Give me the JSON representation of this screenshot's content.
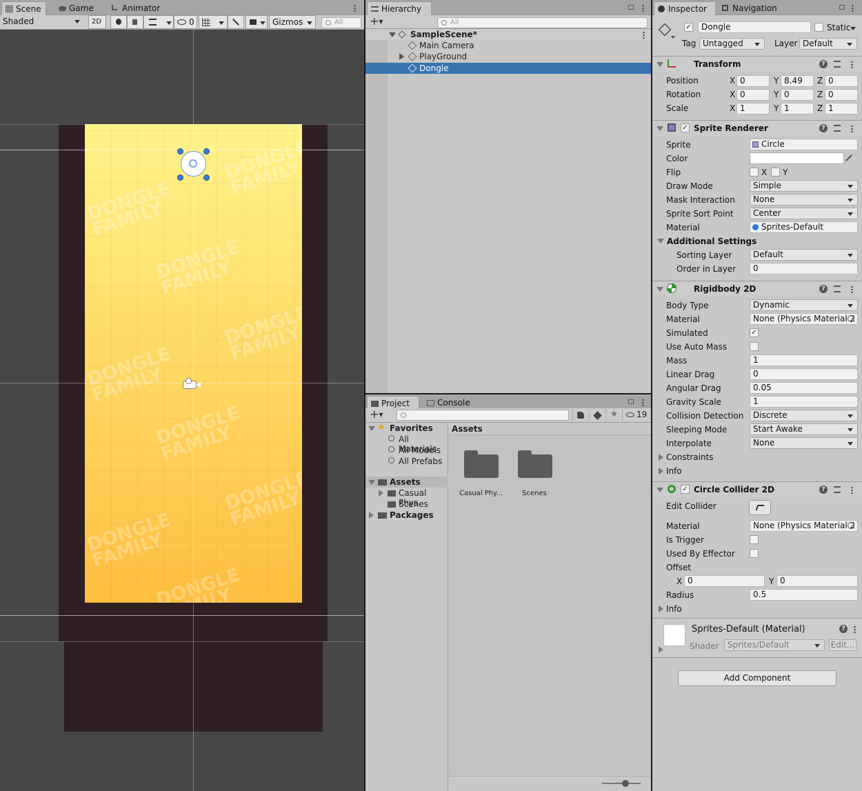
{
  "scene_panel": {
    "tabs": [
      {
        "label": "Scene",
        "active": true
      },
      {
        "label": "Game"
      },
      {
        "label": "Animator"
      }
    ],
    "toolbar": {
      "shading": "Shaded",
      "mode_2d": "2D",
      "hidden_count": "0",
      "gizmos": "Gizmos",
      "search_placeholder": "All"
    },
    "watermark": "DONGLE\nFAMILY",
    "colors": {
      "bg": "#474747",
      "frame": "#2e1f22",
      "grad_top": "#fff38a",
      "grad_bottom": "#ffbe40"
    }
  },
  "hierarchy": {
    "tab": "Hierarchy",
    "search_placeholder": "All",
    "scene": "SampleScene*",
    "items": [
      {
        "label": "Main Camera"
      },
      {
        "label": "PlayGround"
      },
      {
        "label": "Dongle",
        "selected": true
      }
    ]
  },
  "project": {
    "tabs": [
      {
        "label": "Project",
        "active": true
      },
      {
        "label": "Console"
      }
    ],
    "hidden_count": "19",
    "favorites": {
      "label": "Favorites",
      "items": [
        "All Materials",
        "All Models",
        "All Prefabs"
      ]
    },
    "assets": {
      "label": "Assets",
      "items": [
        "Casual Phys",
        "Scenes"
      ]
    },
    "packages": "Packages",
    "breadcrumb": "Assets",
    "grid": [
      {
        "label": "Casual Phy..."
      },
      {
        "label": "Scenes"
      }
    ]
  },
  "inspector": {
    "tabs": [
      {
        "label": "Inspector",
        "active": true
      },
      {
        "label": "Navigation"
      }
    ],
    "object_name": "Dongle",
    "static": "Static",
    "tag_label": "Tag",
    "tag": "Untagged",
    "layer_label": "Layer",
    "layer": "Default",
    "transform": {
      "title": "Transform",
      "rows": [
        {
          "label": "Position",
          "x": "0",
          "y": "8.49",
          "z": "0"
        },
        {
          "label": "Rotation",
          "x": "0",
          "y": "0",
          "z": "0"
        },
        {
          "label": "Scale",
          "x": "1",
          "y": "1",
          "z": "1"
        }
      ]
    },
    "sprite_renderer": {
      "title": "Sprite Renderer",
      "sprite_label": "Sprite",
      "sprite": "Circle",
      "color_label": "Color",
      "flip_label": "Flip",
      "flip_x": "X",
      "flip_y": "Y",
      "draw_mode_label": "Draw Mode",
      "draw_mode": "Simple",
      "mask_label": "Mask Interaction",
      "mask": "None",
      "sort_point_label": "Sprite Sort Point",
      "sort_point": "Center",
      "material_label": "Material",
      "material": "Sprites-Default",
      "additional": "Additional Settings",
      "sorting_layer_label": "Sorting Layer",
      "sorting_layer": "Default",
      "order_label": "Order in Layer",
      "order": "0"
    },
    "rigidbody": {
      "title": "Rigidbody 2D",
      "body_type_label": "Body Type",
      "body_type": "Dynamic",
      "material_label": "Material",
      "material": "None (Physics Material 2",
      "simulated_label": "Simulated",
      "auto_mass_label": "Use Auto Mass",
      "mass_label": "Mass",
      "mass": "1",
      "linear_drag_label": "Linear Drag",
      "linear_drag": "0",
      "angular_drag_label": "Angular Drag",
      "angular_drag": "0.05",
      "gravity_label": "Gravity Scale",
      "gravity": "1",
      "collision_label": "Collision Detection",
      "collision": "Discrete",
      "sleeping_label": "Sleeping Mode",
      "sleeping": "Start Awake",
      "interpolate_label": "Interpolate",
      "interpolate": "None",
      "constraints": "Constraints",
      "info": "Info"
    },
    "circle_collider": {
      "title": "Circle Collider 2D",
      "edit_label": "Edit Collider",
      "material_label": "Material",
      "material": "None (Physics Material 2",
      "trigger_label": "Is Trigger",
      "effector_label": "Used By Effector",
      "offset_label": "Offset",
      "offset_x_label": "X",
      "offset_x": "0",
      "offset_y_label": "Y",
      "offset_y": "0",
      "radius_label": "Radius",
      "radius": "0.5",
      "info": "Info"
    },
    "material": {
      "title": "Sprites-Default (Material)",
      "shader_label": "Shader",
      "shader": "Sprites/Default",
      "edit": "Edit..."
    },
    "add_component": "Add Component"
  }
}
